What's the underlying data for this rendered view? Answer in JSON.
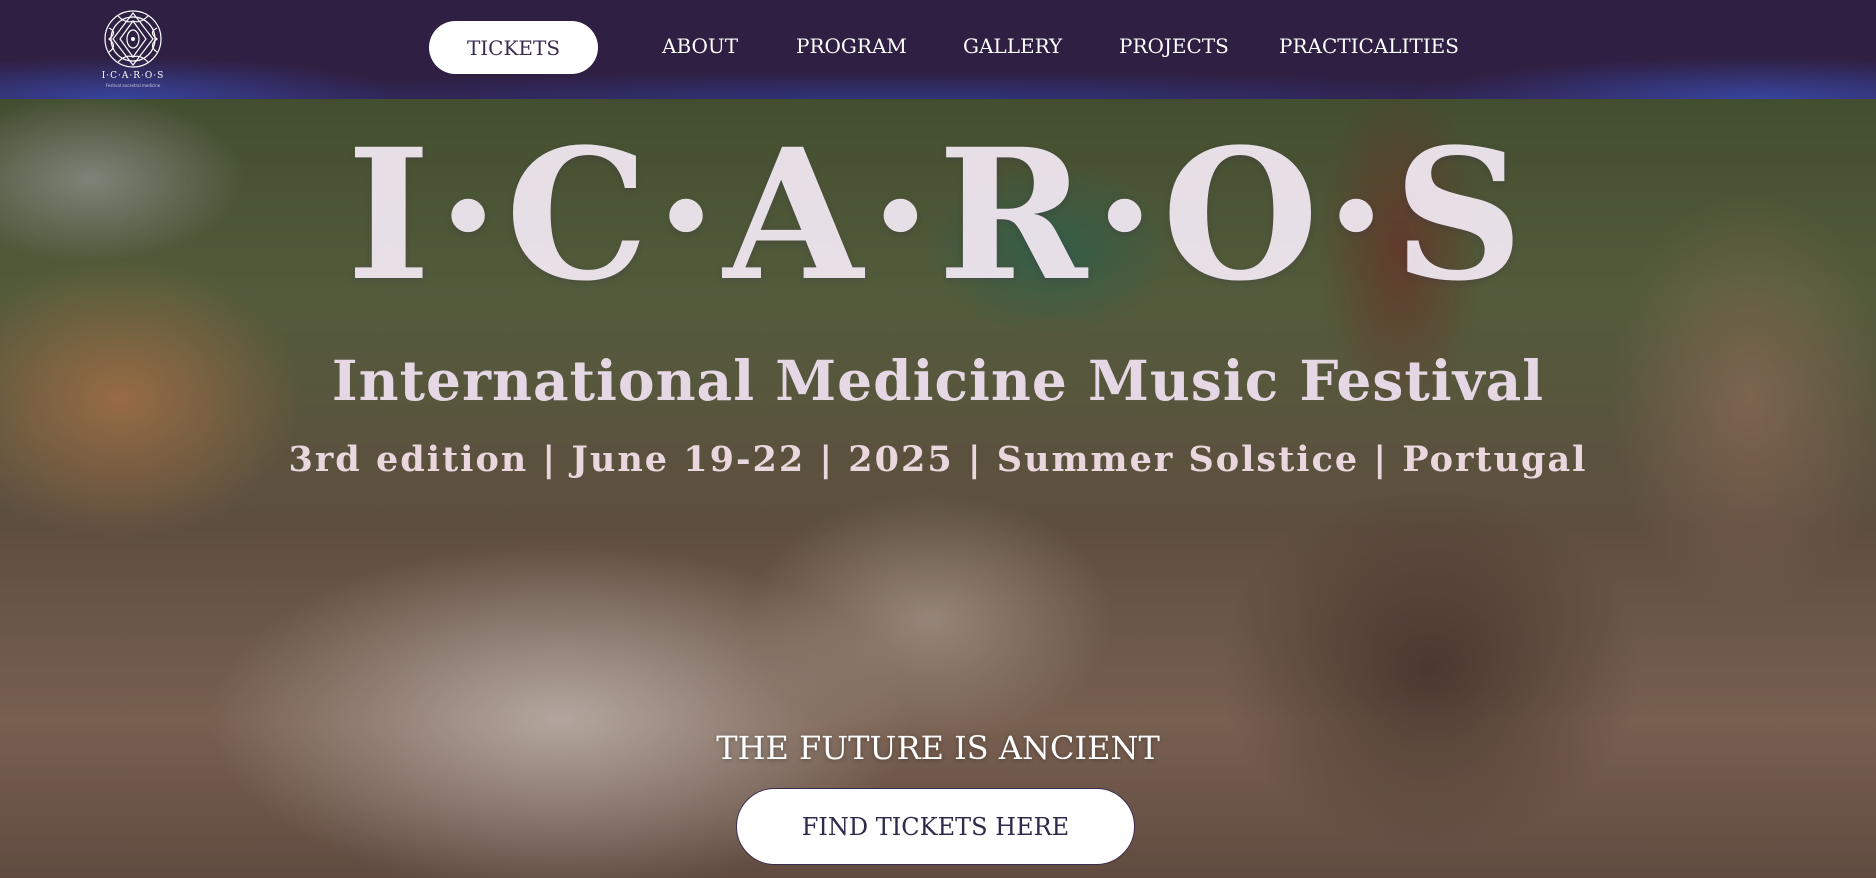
{
  "header": {
    "logo": {
      "icon": "festival-emblem-icon",
      "text": "I·C·A·R·O·S",
      "subtext": "Festival ancestral medicine"
    },
    "tickets_label": "TICKETS",
    "nav": [
      {
        "label": "ABOUT"
      },
      {
        "label": "PROGRAM"
      },
      {
        "label": "GALLERY"
      },
      {
        "label": "PROJECTS"
      },
      {
        "label": "PRACTICALITIES"
      }
    ],
    "colors": {
      "background": "#2f1f42",
      "accent_glow": "#3c50be"
    }
  },
  "hero": {
    "title": "I·C·A·R·O·S",
    "subtitle": "International Medicine Music Festival",
    "details": "3rd edition | June 19-22 | 2025 | Summer Solstice | Portugal",
    "tagline": "THE FUTURE IS ANCIENT",
    "cta_label": "FIND TICKETS HERE"
  }
}
